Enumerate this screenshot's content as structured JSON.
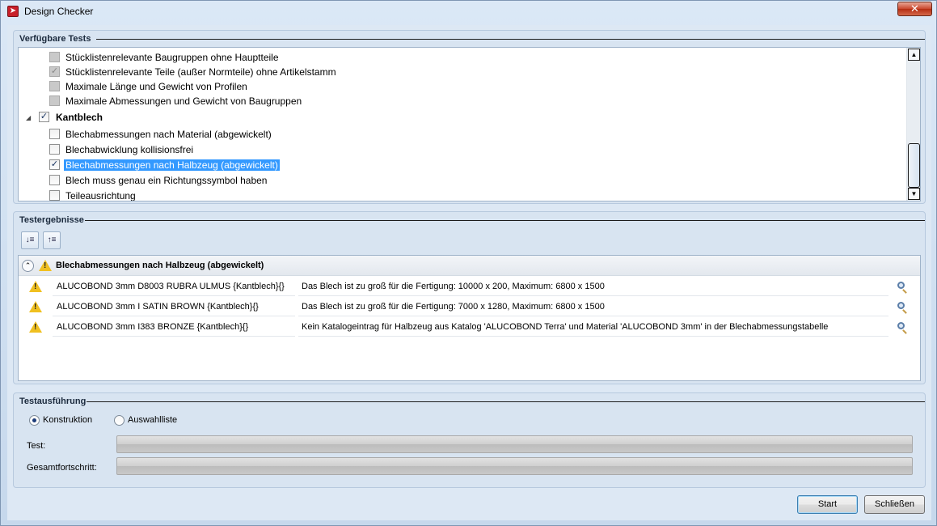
{
  "window": {
    "title": "Design Checker",
    "close_label": "✕"
  },
  "tests": {
    "title": "Verfügbare Tests",
    "items": [
      {
        "label": "Stücklistenrelevante Baugruppen ohne Hauptteile",
        "state": "disabled-unchecked"
      },
      {
        "label": "Stücklistenrelevante Teile (außer Normteile) ohne Artikelstamm",
        "state": "disabled-checked"
      },
      {
        "label": "Maximale Länge und Gewicht von Profilen",
        "state": "disabled-unchecked"
      },
      {
        "label": "Maximale Abmessungen und Gewicht von Baugruppen",
        "state": "disabled-unchecked"
      },
      {
        "label": "Kantblech",
        "state": "checked",
        "group": true
      },
      {
        "label": "Blechabmessungen nach Material (abgewickelt)",
        "state": "unchecked"
      },
      {
        "label": "Blechabwicklung kollisionsfrei",
        "state": "unchecked"
      },
      {
        "label": "Blechabmessungen nach Halbzeug (abgewickelt)",
        "state": "checked",
        "selected": true
      },
      {
        "label": "Blech muss genau ein Richtungssymbol haben",
        "state": "unchecked"
      },
      {
        "label": "Teileausrichtung",
        "state": "unchecked"
      }
    ]
  },
  "results": {
    "title": "Testergebnisse",
    "header": "Blechabmessungen nach Halbzeug (abgewickelt)",
    "rows": [
      {
        "part": "ALUCOBOND 3mm D8003 RUBRA ULMUS {Kantblech}{}",
        "message": "Das Blech ist zu groß für die Fertigung: 10000 x 200, Maximum: 6800 x 1500"
      },
      {
        "part": "ALUCOBOND 3mm I SATIN BROWN {Kantblech}{}",
        "message": "Das Blech ist zu groß für die Fertigung: 7000 x 1280, Maximum: 6800 x 1500"
      },
      {
        "part": "ALUCOBOND 3mm I383 BRONZE {Kantblech}{}",
        "message": "Kein Katalogeintrag für Halbzeug aus Katalog 'ALUCOBOND Terra' und Material 'ALUCOBOND 3mm' in der Blechabmessungstabelle"
      }
    ]
  },
  "execution": {
    "title": "Testausführung",
    "radio_konstruktion": "Konstruktion",
    "radio_auswahlliste": "Auswahlliste",
    "selected": "Konstruktion",
    "test_label": "Test:",
    "overall_label": "Gesamtfortschritt:",
    "test_progress": 0,
    "overall_progress": 0
  },
  "buttons": {
    "start": "Start",
    "close": "Schließen"
  }
}
